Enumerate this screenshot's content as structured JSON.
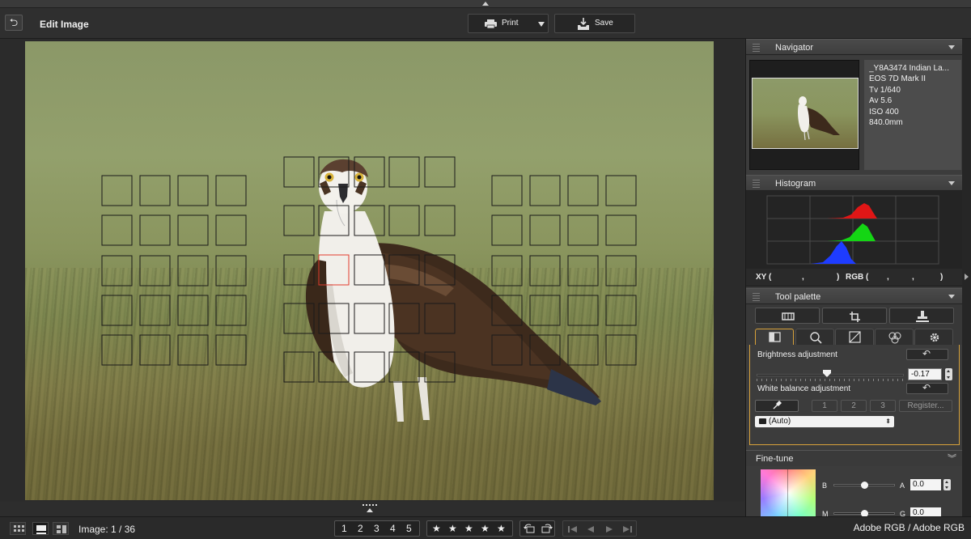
{
  "header": {
    "title": "Edit Image",
    "print_label": "Print",
    "save_label": "Save"
  },
  "navigator": {
    "title": "Navigator",
    "info": [
      "_Y8A3474 Indian La...",
      "EOS 7D Mark II",
      "Tv 1/640",
      "Av 5.6",
      "ISO 400",
      "840.0mm"
    ]
  },
  "histogram": {
    "title": "Histogram",
    "xy_label": "XY (",
    "xy_sep1": ",",
    "xy_close": ")",
    "rgb_label": "RGB (",
    "rgb_sep1": ",",
    "rgb_sep2": ",",
    "rgb_close": ")"
  },
  "tool_palette": {
    "title": "Tool palette",
    "brightness": {
      "label": "Brightness adjustment",
      "value": "-0.17",
      "slider_fraction": 0.48
    },
    "white_balance": {
      "label": "White balance adjustment",
      "buttons": [
        "1",
        "2",
        "3"
      ],
      "register_label": "Register...",
      "mode": "(Auto)"
    }
  },
  "fine_tune": {
    "title": "Fine-tune",
    "b_label": "B",
    "a_label": "A",
    "a_value": "0.0",
    "m_label": "M",
    "g_label": "G",
    "g_value": "0.0",
    "ba_fraction": 0.5,
    "mg_fraction": 0.5
  },
  "bottom_bar": {
    "image_counter": "Image: 1 / 36",
    "color_space": "Adobe RGB / Adobe RGB",
    "ratings": [
      "1",
      "2",
      "3",
      "4",
      "5"
    ],
    "stars": [
      "★",
      "★",
      "★",
      "★",
      "★"
    ]
  },
  "colors": {
    "accent": "#d8a23a",
    "af_point": "#1a1a1a",
    "af_active": "#e23b2e"
  },
  "icons": {
    "back": "back-arrow-icon",
    "print": "printer-icon",
    "save": "save-icon"
  }
}
